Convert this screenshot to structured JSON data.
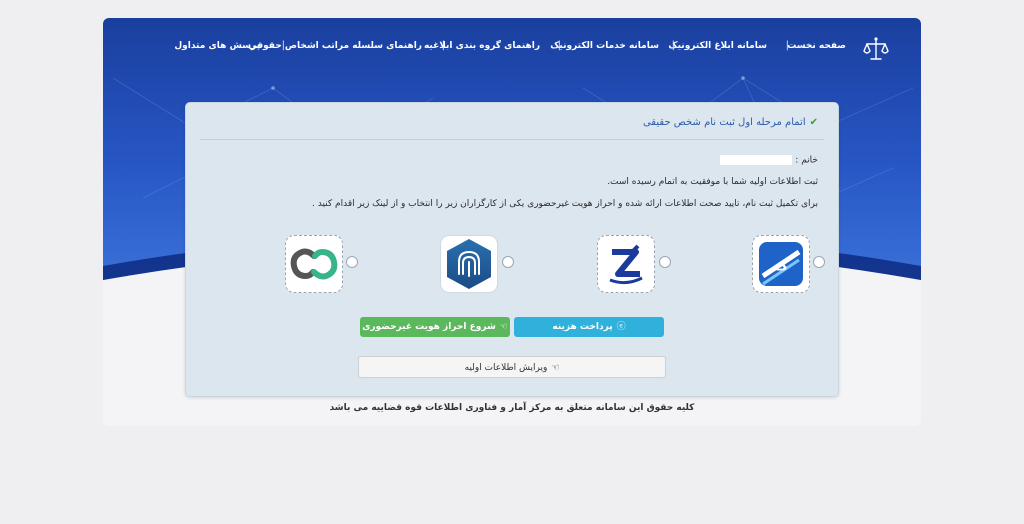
{
  "nav": {
    "items": [
      "صفحه نخست",
      "سامانه ابلاغ الکترونیک",
      "سامانه خدمات الکترونیک",
      "راهنمای گروه بندی ابلاغیه",
      "راهنمای سلسله مراتب اشخاص حقوقی",
      "پرسش های متداول"
    ],
    "separator": "|",
    "logo_icon": "scales-of-justice-icon"
  },
  "card": {
    "title": "اتمام مرحله اول ثبت نام شخص حقیقی",
    "title_icon": "check-icon",
    "greeting": "خانم :",
    "success_message": "ثبت اطلاعات اولیه شما با موفقیت به اتمام رسیده است.",
    "instruction": "برای تکمیل ثبت نام، تایید صحت اطلاعات ارائه شده و احراز هویت غیرحضوری یکی از کارگزاران زیر را انتخاب و از لینک زیر اقدام کنید ."
  },
  "providers": [
    {
      "name": "provider-1",
      "icon": "provider-logo-blue-badge-icon"
    },
    {
      "name": "provider-2",
      "icon": "provider-logo-blue-z-icon"
    },
    {
      "name": "provider-3",
      "icon": "provider-logo-fingerprint-icon"
    },
    {
      "name": "provider-4",
      "icon": "provider-logo-chain-link-icon"
    }
  ],
  "buttons": {
    "pay": "پرداخت هزینه",
    "pay_icon": "browser-e-icon",
    "start_auth": "شروع احراز هویت غیرحضوری",
    "start_auth_icon": "hand-pointer-icon",
    "edit": "ویرایش اطلاعات اولیه",
    "edit_icon": "hand-pointer-icon"
  },
  "footer": "کلیه حقوق این سامانه متعلق به مرکز آمار و فناوری اطلاعات قوه قضاییه می باشد",
  "colors": {
    "header_blue": "#1f4db0",
    "card_bg": "#dce6ef",
    "pay_button": "#2fb1db",
    "auth_button": "#5cb85c",
    "title_link": "#2a5caa"
  }
}
